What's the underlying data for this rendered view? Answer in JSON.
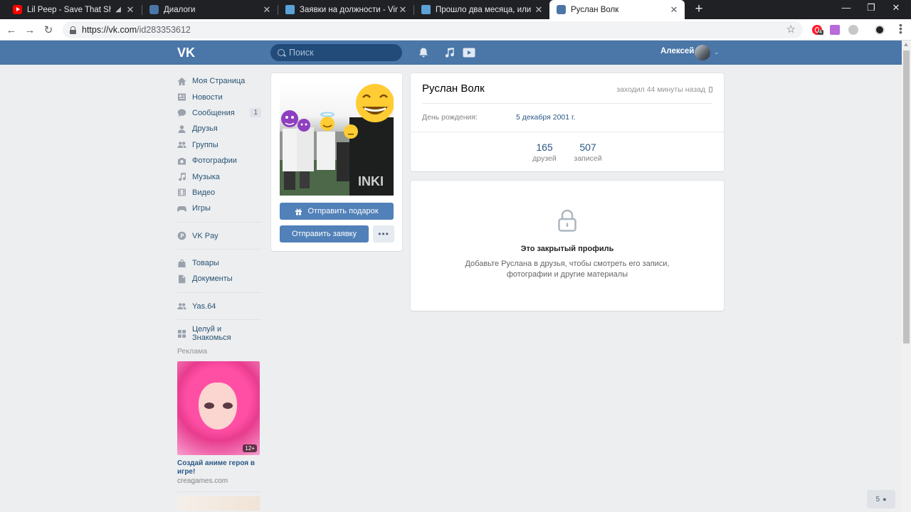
{
  "browser": {
    "tabs": [
      {
        "title": "Lil Peep - Save That Shit (O",
        "icon": "youtube-icon",
        "audio": true
      },
      {
        "title": "Диалоги",
        "icon": "vk-chat-icon"
      },
      {
        "title": "Заявки на должности - Vime",
        "icon": "vimeworld-icon"
      },
      {
        "title": "Прошло два месяца, или бол",
        "icon": "vimeworld-icon"
      },
      {
        "title": "Руслан Волк",
        "icon": "vk-icon",
        "active": true
      }
    ],
    "url_main": "https://vk.com",
    "url_path": "/id283353612"
  },
  "vk": {
    "search_placeholder": "Поиск",
    "user_name": "Алексей",
    "menu": [
      {
        "label": "Моя Страница",
        "icon": "home-icon"
      },
      {
        "label": "Новости",
        "icon": "news-icon"
      },
      {
        "label": "Сообщения",
        "icon": "messages-icon",
        "count": "1"
      },
      {
        "label": "Друзья",
        "icon": "friends-icon"
      },
      {
        "label": "Группы",
        "icon": "groups-icon"
      },
      {
        "label": "Фотографии",
        "icon": "camera-icon"
      },
      {
        "label": "Музыка",
        "icon": "music-icon"
      },
      {
        "label": "Видео",
        "icon": "video-icon"
      },
      {
        "label": "Игры",
        "icon": "gamepad-icon"
      },
      {
        "label": "VK Pay",
        "icon": "vkpay-icon"
      },
      {
        "label": "Товары",
        "icon": "bag-icon"
      },
      {
        "label": "Документы",
        "icon": "document-icon"
      },
      {
        "label": "Yas.64",
        "icon": "group-icon"
      },
      {
        "label": "Целуй и Знакомься",
        "icon": "apps-icon"
      }
    ],
    "ads": {
      "title": "Реклама",
      "age": "12+",
      "name": "Создай аниме героя в игре!",
      "domain": "creagames.com"
    },
    "profile": {
      "send_gift": "Отправить подарок",
      "send_request": "Отправить заявку",
      "more": "•••",
      "name": "Руслан Волк",
      "last_seen": "заходил 44 минуты назад",
      "birthday_label": "День рождения:",
      "birthday_value": "5 декабря 2001 г.",
      "stats": [
        {
          "number": "165",
          "label": "друзей"
        },
        {
          "number": "507",
          "label": "записей"
        }
      ],
      "closed_title": "Это закрытый профиль",
      "closed_text": "Добавьте Руслана в друзья, чтобы смотреть его записи, фотографии и другие материалы"
    },
    "pager": "5"
  },
  "colors": {
    "vk_blue": "#4a76a8",
    "vk_button": "#5181b8",
    "page_bg": "#edeef0",
    "link": "#2a5885"
  }
}
